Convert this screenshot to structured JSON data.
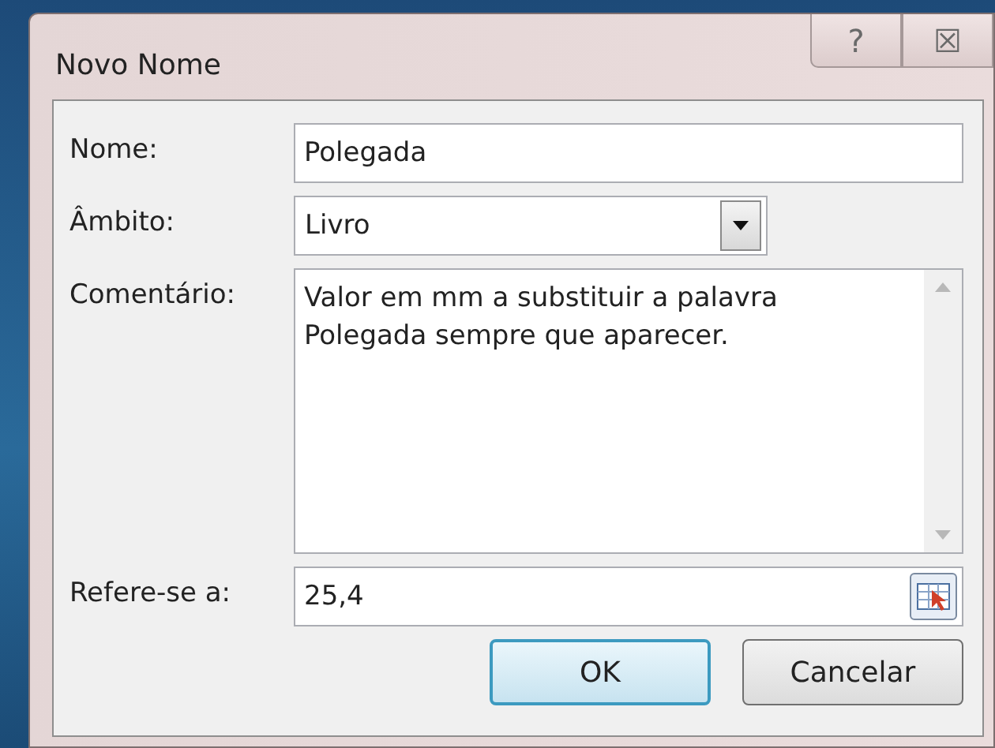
{
  "window": {
    "title": "Novo Nome"
  },
  "title_buttons": [
    {
      "label": "?"
    },
    {
      "label": "☒"
    }
  ],
  "fields": [
    {
      "kind": "text",
      "label": "Nome:",
      "value": "Polegada"
    },
    {
      "kind": "dropdown",
      "label": "Âmbito:",
      "value": "Livro"
    },
    {
      "kind": "textarea",
      "label": "Comentário:",
      "value": "Valor em mm a substituir a palavra\nPolegada sempre que aparecer."
    },
    {
      "kind": "reference",
      "label": "Refere-se a:",
      "value": "25,4"
    }
  ],
  "buttons": [
    {
      "label": "OK",
      "default": true
    },
    {
      "label": "Cancelar",
      "default": false
    }
  ]
}
